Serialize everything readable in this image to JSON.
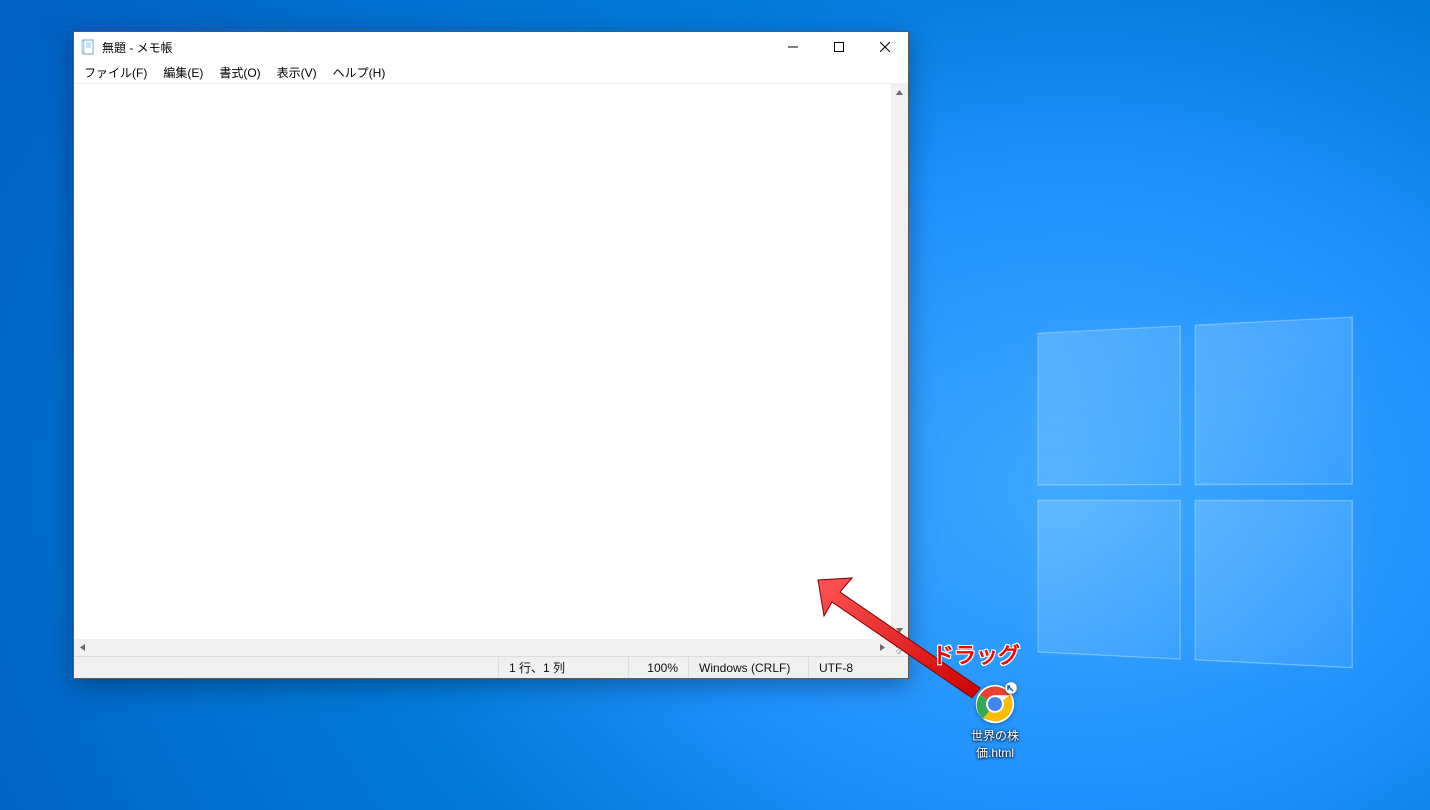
{
  "window": {
    "title": "無題 - メモ帳"
  },
  "menubar": {
    "items": [
      "ファイル(F)",
      "編集(E)",
      "書式(O)",
      "表示(V)",
      "ヘルプ(H)"
    ]
  },
  "editor": {
    "content": ""
  },
  "statusbar": {
    "position": "1 行、1 列",
    "zoom": "100%",
    "line_ending": "Windows (CRLF)",
    "encoding": "UTF-8"
  },
  "desktop": {
    "file_label": "世界の株価.html"
  },
  "annotation": {
    "label": "ドラッグ"
  }
}
